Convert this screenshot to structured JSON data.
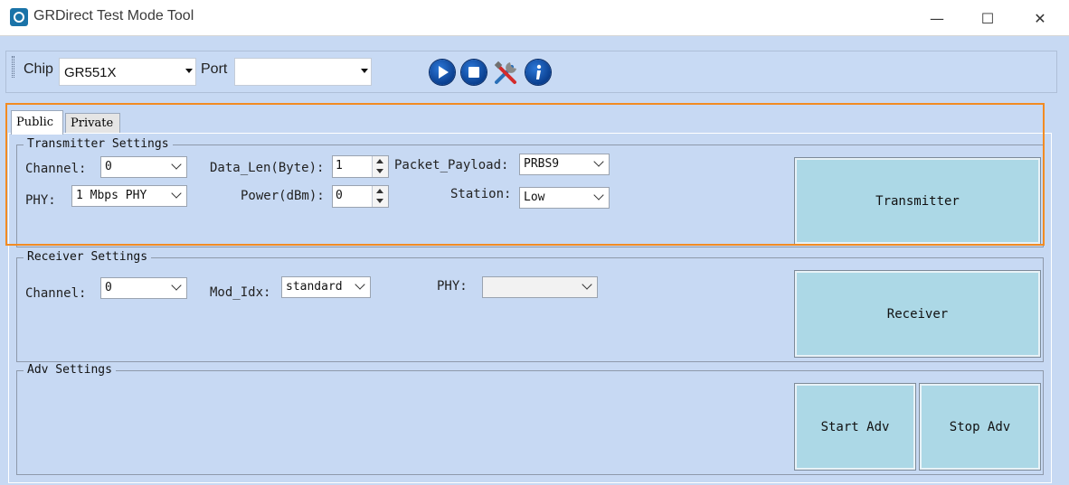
{
  "window": {
    "title": "GRDirect Test Mode Tool",
    "minimize": "—",
    "maximize": "☐",
    "close": "✕"
  },
  "toolbar": {
    "chip_label": "Chip",
    "chip_value": "GR551X",
    "port_label": "Port",
    "port_value": "",
    "icons": [
      "play-icon",
      "stop-icon",
      "tools-icon",
      "info-icon"
    ]
  },
  "tabs": [
    {
      "label": "Public",
      "selected": true
    },
    {
      "label": "Private",
      "selected": false
    }
  ],
  "transmitter": {
    "title": "Transmitter Settings",
    "channel_label": "Channel:",
    "channel_value": "0",
    "phy_label": "PHY:",
    "phy_value": "1 Mbps PHY",
    "data_len_label": "Data_Len(Byte):",
    "data_len_value": "1",
    "power_label": "Power(dBm):",
    "power_value": "0",
    "payload_label": "Packet_Payload:",
    "payload_value": "PRBS9",
    "station_label": "Station:",
    "station_value": "Low",
    "button": "Transmitter"
  },
  "receiver": {
    "title": "Receiver Settings",
    "channel_label": "Channel:",
    "channel_value": "0",
    "mod_idx_label": "Mod_Idx:",
    "mod_idx_value": "standard",
    "phy_label": "PHY:",
    "phy_value": "",
    "button": "Receiver"
  },
  "adv": {
    "title": "Adv Settings",
    "start_button": "Start Adv",
    "stop_button": "Stop Adv"
  },
  "colors": {
    "background": "#c7d9f3",
    "button": "#acd8e6",
    "highlight": "#f28b22"
  }
}
